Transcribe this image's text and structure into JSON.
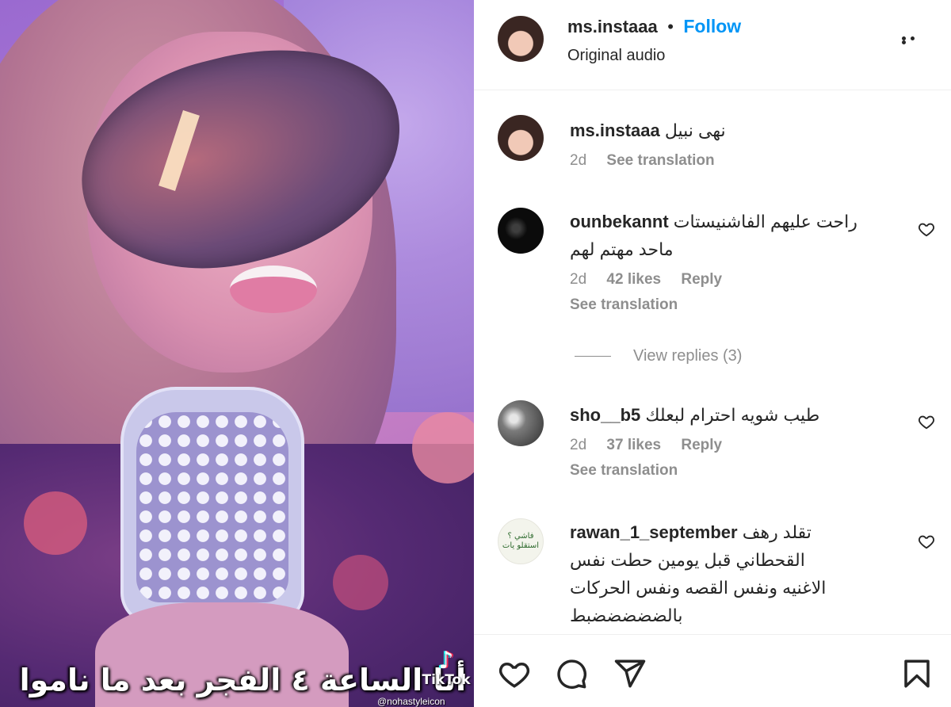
{
  "media": {
    "caption": "أنا الساعة ٤ الفجر بعد ما ناموا",
    "watermark": "TikTok",
    "handle": "@nohastyleicon"
  },
  "header": {
    "username": "ms.instaaa",
    "separator": "•",
    "follow_label": "Follow",
    "audio": "Original audio",
    "more_icon": "more-options-icon"
  },
  "comments": [
    {
      "username": "ms.instaaa",
      "lines": [
        "نهى نبيل"
      ],
      "time": "2d",
      "likes": "",
      "reply": "",
      "translation": "See translation"
    },
    {
      "username": "ounbekannt",
      "lines": [
        "راحت عليهم الفاشنيستات",
        "ماحد مهتم لهم"
      ],
      "time": "2d",
      "likes": "42 likes",
      "reply": "Reply",
      "translation": "See translation",
      "view_replies": "View replies (3)"
    },
    {
      "username": "sho__b5",
      "lines": [
        "طيب شويه احترام لبعلك"
      ],
      "time": "2d",
      "likes": "37 likes",
      "reply": "Reply",
      "translation": "See translation"
    },
    {
      "username": "rawan_1_september",
      "avatar_text": "فاشي ؟ استقلو يات",
      "lines": [
        "تقلد رهف",
        "القحطاني قبل يومين حطت نفس",
        "الاغنيه ونفس القصه ونفس الحركات",
        "بالضضضضضبط"
      ]
    }
  ],
  "actions": {
    "icons": [
      "heart-icon",
      "comment-icon",
      "share-icon",
      "bookmark-icon"
    ]
  },
  "colors": {
    "accent": "#0095f6",
    "text": "#262626",
    "muted": "#8e8e8e"
  }
}
